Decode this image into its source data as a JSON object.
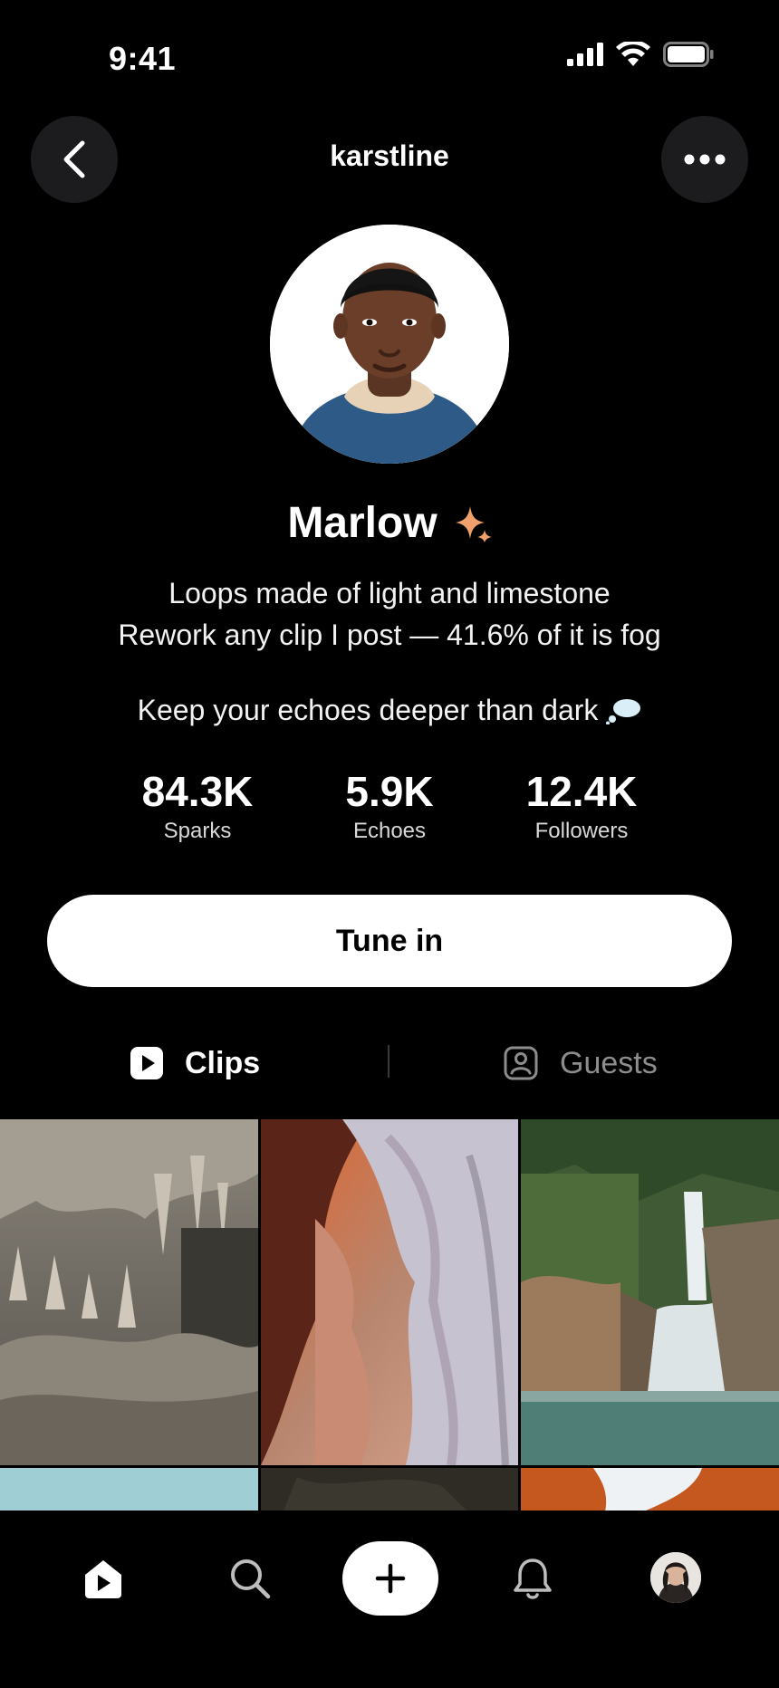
{
  "status_bar": {
    "time": "9:41"
  },
  "header": {
    "username": "karstline"
  },
  "profile": {
    "name": "Marlow",
    "bio_line1": "Loops made of light and limestone",
    "bio_line2": "Rework any clip I post — 41.6% of it is fog",
    "tagline": "Keep your echoes deeper than dark"
  },
  "stats": [
    {
      "value": "84.3K",
      "label": "Sparks"
    },
    {
      "value": "5.9K",
      "label": "Echoes"
    },
    {
      "value": "12.4K",
      "label": "Followers"
    }
  ],
  "cta": {
    "label": "Tune in"
  },
  "tabs": [
    {
      "label": "Clips",
      "icon": "play-square-icon",
      "active": true
    },
    {
      "label": "Guests",
      "icon": "person-square-icon",
      "active": false
    }
  ],
  "grid": [
    {
      "subject": "cave stalagmites"
    },
    {
      "subject": "slot canyon"
    },
    {
      "subject": "waterfall"
    },
    {
      "subject": "sky"
    },
    {
      "subject": "dark rock"
    },
    {
      "subject": "red rock arch"
    }
  ],
  "bottom_nav": [
    {
      "icon": "home-icon"
    },
    {
      "icon": "search-icon"
    },
    {
      "icon": "plus-icon"
    },
    {
      "icon": "bell-icon"
    },
    {
      "icon": "profile-avatar"
    }
  ],
  "colors": {
    "accent_sparkle": "#f0a06a",
    "background": "#000000",
    "button_bg": "#ffffff"
  }
}
